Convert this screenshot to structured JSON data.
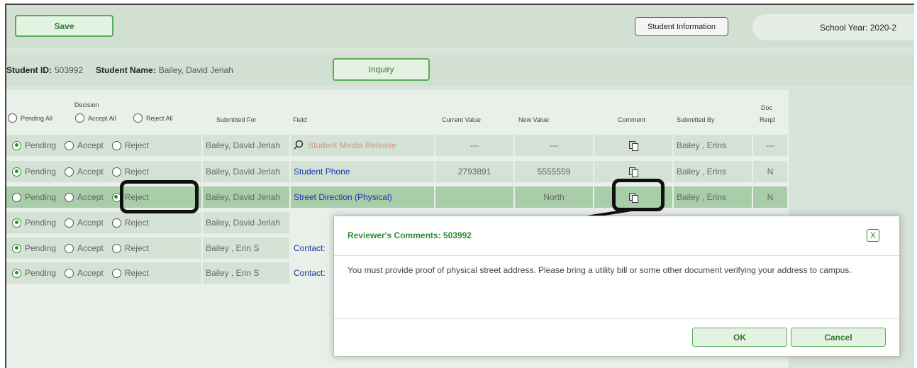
{
  "toolbar": {
    "save_label": "Save",
    "student_info_label": "Student Information",
    "school_year": "School Year: 2020-2"
  },
  "student": {
    "id_label": "Student ID:",
    "id_value": "503992",
    "name_label": "Student Name:",
    "name_value": "Bailey, David Jeriah",
    "inquiry_label": "Inquiry"
  },
  "table": {
    "decision_header": "Decision",
    "pending_all": "Pending All",
    "accept_all": "Accept All",
    "reject_all": "Reject All",
    "columns": [
      "Submitted For",
      "Field",
      "Current Value",
      "New Value",
      "Comment",
      "Submitted By",
      "Doc",
      "Reqd"
    ],
    "radio_labels": {
      "pending": "Pending",
      "accept": "Accept",
      "reject": "Reject"
    },
    "rows": [
      {
        "decision": "pending",
        "submitted_for": "Bailey, David Jeriah",
        "field": "Student Media Release",
        "current": "---",
        "new": "---",
        "has_comment": true,
        "submitted_by": "Bailey , Erins",
        "doc": "---"
      },
      {
        "decision": "pending",
        "submitted_for": "Bailey, David Jeriah",
        "field": "Student Phone",
        "current": "2793891",
        "new": "5555559",
        "has_comment": true,
        "submitted_by": "Bailey , Erins",
        "doc": "N"
      },
      {
        "decision": "reject",
        "submitted_for": "Bailey, David Jeriah",
        "field": "Street Direction (Physical)",
        "current": "",
        "new": "North",
        "has_comment": true,
        "submitted_by": "Bailey , Erins",
        "doc": "N"
      },
      {
        "decision": "pending",
        "submitted_for": "Bailey, David Jeriah",
        "field": "",
        "current": "",
        "new": "",
        "has_comment": false,
        "submitted_by": "",
        "doc": ""
      },
      {
        "decision": "pending",
        "submitted_for": "Bailey , Erin S",
        "field": "Contact:",
        "current": "",
        "new": "",
        "has_comment": false,
        "submitted_by": "",
        "doc": ""
      },
      {
        "decision": "pending",
        "submitted_for": "Bailey , Erin S",
        "field": "Contact:",
        "current": "",
        "new": "",
        "has_comment": false,
        "submitted_by": "",
        "doc": ""
      }
    ]
  },
  "modal": {
    "title": "Reviewer's Comments: 503992",
    "close_label": "X",
    "body": "You must provide proof of physical street address. Please bring a utility bill or some other document verifying your address to campus.",
    "ok_label": "OK",
    "cancel_label": "Cancel"
  },
  "icons": {
    "magnifier": "search-icon",
    "comment": "document-copy-icon",
    "arrow": "arrow-icon"
  }
}
